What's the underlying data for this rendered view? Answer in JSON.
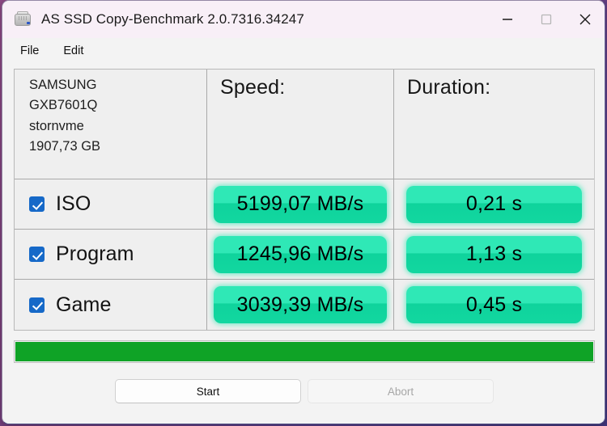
{
  "window": {
    "title": "AS SSD Copy-Benchmark 2.0.7316.34247",
    "icon": "ssd-drive-icon",
    "caption": {
      "minimize": "minimize-icon",
      "maximize": "maximize-icon",
      "close": "close-icon"
    }
  },
  "menubar": {
    "items": [
      {
        "label": "File"
      },
      {
        "label": "Edit"
      }
    ]
  },
  "drive": {
    "vendor": "SAMSUNG",
    "model": "GXB7601Q",
    "driver": "stornvme",
    "capacity": "1907,73 GB"
  },
  "table": {
    "headers": {
      "name": "",
      "speed": "Speed:",
      "duration": "Duration:"
    },
    "rows": [
      {
        "label": "ISO",
        "checked": true,
        "speed": "5199,07 MB/s",
        "duration": "0,21 s"
      },
      {
        "label": "Program",
        "checked": true,
        "speed": "1245,96 MB/s",
        "duration": "1,13 s"
      },
      {
        "label": "Game",
        "checked": true,
        "speed": "3039,39 MB/s",
        "duration": "0,45 s"
      }
    ]
  },
  "progress": {
    "percent": 100,
    "fill_color": "#0fa326"
  },
  "buttons": {
    "start": {
      "label": "Start",
      "enabled": true
    },
    "abort": {
      "label": "Abort",
      "enabled": false
    }
  },
  "colors": {
    "titlebar": "#f8eff7",
    "client": "#f3f3f3",
    "value_pill": "#2fe8b6",
    "checkbox": "#1669c8",
    "progress": "#0fa326"
  }
}
